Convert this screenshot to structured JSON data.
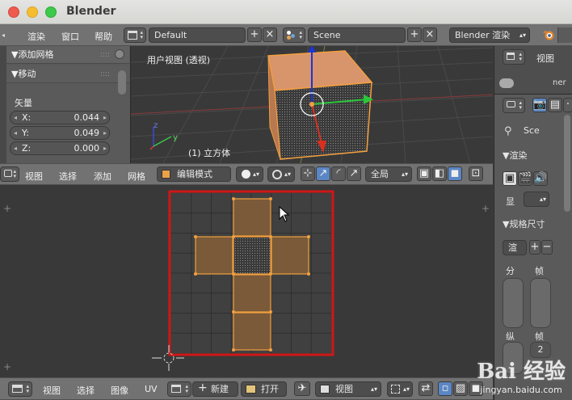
{
  "app": {
    "title": "Blender"
  },
  "info_header": {
    "menus": [
      "渲染",
      "窗口",
      "帮助"
    ],
    "screen_layout": "Default",
    "scene": "Scene",
    "render_engine": "Blender 渲染"
  },
  "tool_panel": {
    "add_mesh": "▼添加网格",
    "move": "▼移动",
    "vector_label": "矢量",
    "fields": [
      {
        "label": "X:",
        "value": "0.044"
      },
      {
        "label": "Y:",
        "value": "0.049"
      },
      {
        "label": "Z:",
        "value": "0.000"
      }
    ]
  },
  "viewport3d": {
    "view_label": "用户视图 (透视)",
    "object_label": "(1) 立方体",
    "axis_z": "z",
    "axis_y": "y"
  },
  "viewport_header": {
    "menus": [
      "视图",
      "选择",
      "添加",
      "网格"
    ],
    "mode": "编辑模式",
    "pivot": "全局"
  },
  "uv_header": {
    "menus": [
      "视图",
      "选择",
      "图像",
      "UV"
    ],
    "new_label": "新建",
    "open_label": "打开",
    "view_label": "视图"
  },
  "right_panel": {
    "view_label": "视图",
    "scene_short": "Sce",
    "render_label": "▼渲染",
    "display_short": "显",
    "dimensions_label": "▼规格尺寸",
    "render_short": "渲",
    "split_labels": [
      "分",
      "帧"
    ],
    "split_labels2": [
      "纵",
      "帧"
    ],
    "frame_value": "2",
    "ner": "ner"
  },
  "watermark": {
    "main": "Bai 经验",
    "sub": "jingyan.baidu.com"
  },
  "colors": {
    "selection_red": "#d01717",
    "face_orange": "#e8a060",
    "uv_face": "#7a5a38"
  }
}
